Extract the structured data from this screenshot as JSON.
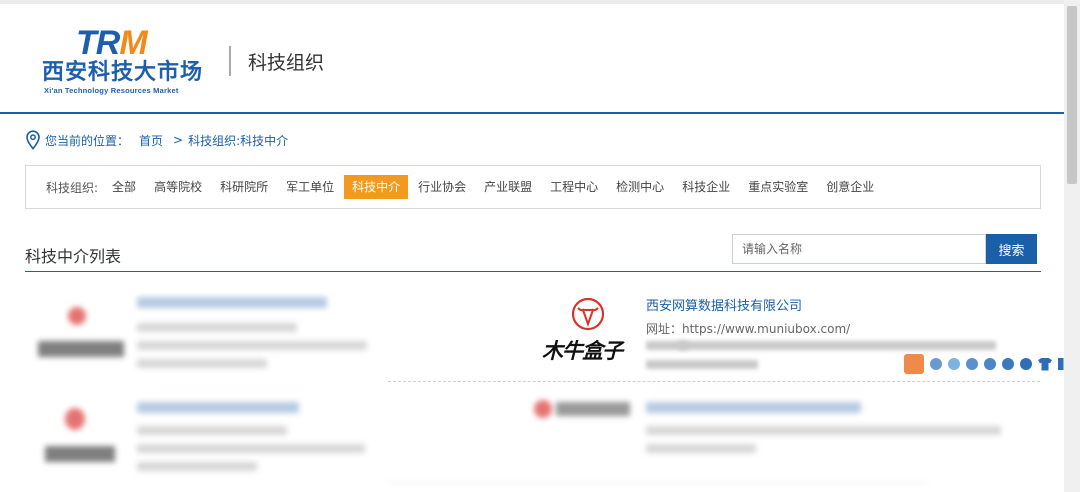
{
  "logo": {
    "mark_tr": "TR",
    "mark_m": "M",
    "cn": "西安科技大市场",
    "en": "Xi'an Technology Resources Market",
    "colors": {
      "blue": "#1d5fae",
      "orange": "#f08a1a"
    }
  },
  "header": {
    "section_title": "科技组织"
  },
  "breadcrumb": {
    "label": "您当前的位置：",
    "home": "首页",
    "separator": ">",
    "current": "科技组织:科技中介"
  },
  "filter": {
    "label": "科技组织:",
    "items": [
      {
        "label": "全部",
        "active": false
      },
      {
        "label": "高等院校",
        "active": false
      },
      {
        "label": "科研院所",
        "active": false
      },
      {
        "label": "军工单位",
        "active": false
      },
      {
        "label": "科技中介",
        "active": true
      },
      {
        "label": "行业协会",
        "active": false
      },
      {
        "label": "产业联盟",
        "active": false
      },
      {
        "label": "工程中心",
        "active": false
      },
      {
        "label": "检测中心",
        "active": false
      },
      {
        "label": "科技企业",
        "active": false
      },
      {
        "label": "重点实验室",
        "active": false
      },
      {
        "label": "创意企业",
        "active": false
      }
    ]
  },
  "list": {
    "title": "科技中介列表",
    "search": {
      "placeholder": "请输入名称",
      "button_label": "搜索"
    },
    "featured": {
      "logo_text": "木牛盒子",
      "name": "西安网算数据科技有限公司",
      "website": "网址：https://www.muniubox.com/"
    }
  },
  "colors": {
    "primary": "#1a5fa8",
    "accent": "#f39a1e"
  }
}
